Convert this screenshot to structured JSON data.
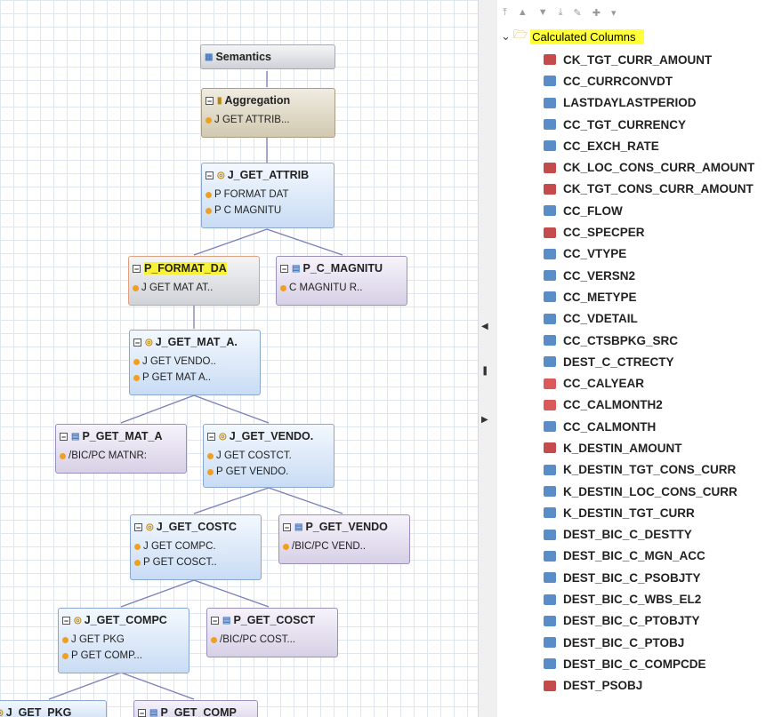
{
  "canvas": {
    "nodes": {
      "semantics": {
        "title": "Semantics"
      },
      "aggregation": {
        "title": "Aggregation",
        "rows": [
          "J GET ATTRIB..."
        ]
      },
      "j_get_attrib": {
        "title": "J_GET_ATTRIB",
        "rows": [
          "P FORMAT DAT",
          "P C MAGNITU"
        ]
      },
      "p_format_da": {
        "title": "P_FORMAT_DA",
        "rows": [
          "J GET MAT AT.."
        ]
      },
      "p_c_magnitu": {
        "title": "P_C_MAGNITU",
        "rows": [
          "C MAGNITU R.."
        ]
      },
      "j_get_mat_a": {
        "title": "J_GET_MAT_A.",
        "rows": [
          "J GET VENDO..",
          "P GET MAT A.."
        ]
      },
      "p_get_mat_a": {
        "title": "P_GET_MAT_A",
        "rows": [
          "/BIC/PC MATNR:"
        ]
      },
      "j_get_vendo": {
        "title": "J_GET_VENDO.",
        "rows": [
          "J GET COSTCT.",
          "P GET VENDO."
        ]
      },
      "j_get_costc": {
        "title": "J_GET_COSTC",
        "rows": [
          "J GET COMPC.",
          "P GET COSCT.."
        ]
      },
      "p_get_vendo": {
        "title": "P_GET_VENDO",
        "rows": [
          "/BIC/PC VEND.."
        ]
      },
      "j_get_compc": {
        "title": "J_GET_COMPC",
        "rows": [
          "J GET PKG",
          "P GET COMP..."
        ]
      },
      "p_get_cosct": {
        "title": "P_GET_COSCT",
        "rows": [
          "/BIC/PC COST..."
        ]
      },
      "j_get_pkg": {
        "title": "J_GET_PKG"
      },
      "p_get_comp": {
        "title": "P_GET_COMP"
      }
    }
  },
  "panel": {
    "root_label": "Calculated Columns",
    "items": [
      {
        "label": "CK_TGT_CURR_AMOUNT",
        "icon": "key"
      },
      {
        "label": "CC_CURRCONVDT",
        "icon": "calc"
      },
      {
        "label": "LASTDAYLASTPERIOD",
        "icon": "calc"
      },
      {
        "label": "CC_TGT_CURRENCY",
        "icon": "calc"
      },
      {
        "label": "CC_EXCH_RATE",
        "icon": "calc"
      },
      {
        "label": "CK_LOC_CONS_CURR_AMOUNT",
        "icon": "key"
      },
      {
        "label": "CK_TGT_CONS_CURR_AMOUNT",
        "icon": "key"
      },
      {
        "label": "CC_FLOW",
        "icon": "calc"
      },
      {
        "label": "CC_SPECPER",
        "icon": "key"
      },
      {
        "label": "CC_VTYPE",
        "icon": "calc"
      },
      {
        "label": "CC_VERSN2",
        "icon": "calc"
      },
      {
        "label": "CC_METYPE",
        "icon": "calc"
      },
      {
        "label": "CC_VDETAIL",
        "icon": "calc"
      },
      {
        "label": "CC_CTSBPKG_SRC",
        "icon": "calc"
      },
      {
        "label": "DEST_C_CTRECTY",
        "icon": "calc"
      },
      {
        "label": "CC_CALYEAR",
        "icon": "date"
      },
      {
        "label": "CC_CALMONTH2",
        "icon": "date"
      },
      {
        "label": "CC_CALMONTH",
        "icon": "calc"
      },
      {
        "label": "K_DESTIN_AMOUNT",
        "icon": "key"
      },
      {
        "label": "K_DESTIN_TGT_CONS_CURR",
        "icon": "calc"
      },
      {
        "label": "K_DESTIN_LOC_CONS_CURR",
        "icon": "calc"
      },
      {
        "label": "K_DESTIN_TGT_CURR",
        "icon": "calc"
      },
      {
        "label": "DEST_BIC_C_DESTTY",
        "icon": "calc"
      },
      {
        "label": "DEST_BIC_C_MGN_ACC",
        "icon": "calc"
      },
      {
        "label": "DEST_BIC_C_PSOBJTY",
        "icon": "calc"
      },
      {
        "label": "DEST_BIC_C_WBS_EL2",
        "icon": "calc"
      },
      {
        "label": "DEST_BIC_C_PTOBJTY",
        "icon": "calc"
      },
      {
        "label": "DEST_BIC_C_PTOBJ",
        "icon": "calc"
      },
      {
        "label": "DEST_BIC_C_COMPCDE",
        "icon": "calc"
      },
      {
        "label": "DEST_PSOBJ",
        "icon": "key"
      }
    ]
  }
}
